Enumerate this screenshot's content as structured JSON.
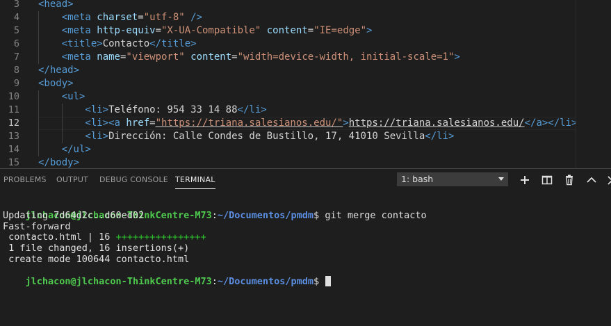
{
  "editor": {
    "lines": [
      {
        "num": "3",
        "active": false,
        "indent": 0,
        "tokens": [
          {
            "t": "tag",
            "v": "<head>"
          }
        ]
      },
      {
        "num": "4",
        "active": false,
        "indent": 1,
        "tokens": [
          {
            "t": "tag",
            "v": "<meta "
          },
          {
            "t": "attr",
            "v": "charset"
          },
          {
            "t": "txt",
            "v": "="
          },
          {
            "t": "str",
            "v": "\"utf-8\""
          },
          {
            "t": "tag",
            "v": " />"
          }
        ]
      },
      {
        "num": "5",
        "active": false,
        "indent": 1,
        "tokens": [
          {
            "t": "tag",
            "v": "<meta "
          },
          {
            "t": "attr",
            "v": "http-equiv"
          },
          {
            "t": "txt",
            "v": "="
          },
          {
            "t": "str",
            "v": "\"X-UA-Compatible\""
          },
          {
            "t": "txt",
            "v": " "
          },
          {
            "t": "attr",
            "v": "content"
          },
          {
            "t": "txt",
            "v": "="
          },
          {
            "t": "str",
            "v": "\"IE=edge\""
          },
          {
            "t": "tag",
            "v": ">"
          }
        ]
      },
      {
        "num": "6",
        "active": false,
        "indent": 1,
        "tokens": [
          {
            "t": "tag",
            "v": "<title>"
          },
          {
            "t": "txt",
            "v": "Contacto"
          },
          {
            "t": "tag",
            "v": "</title>"
          }
        ]
      },
      {
        "num": "7",
        "active": false,
        "indent": 1,
        "tokens": [
          {
            "t": "tag",
            "v": "<meta "
          },
          {
            "t": "attr",
            "v": "name"
          },
          {
            "t": "txt",
            "v": "="
          },
          {
            "t": "str",
            "v": "\"viewport\""
          },
          {
            "t": "txt",
            "v": " "
          },
          {
            "t": "attr",
            "v": "content"
          },
          {
            "t": "txt",
            "v": "="
          },
          {
            "t": "str",
            "v": "\"width=device-width, initial-scale=1\""
          },
          {
            "t": "tag",
            "v": ">"
          }
        ]
      },
      {
        "num": "8",
        "active": false,
        "indent": 0,
        "tokens": [
          {
            "t": "tag",
            "v": "</head>"
          }
        ]
      },
      {
        "num": "9",
        "active": false,
        "indent": 0,
        "tokens": [
          {
            "t": "tag",
            "v": "<body>"
          }
        ]
      },
      {
        "num": "10",
        "active": false,
        "indent": 1,
        "tokens": [
          {
            "t": "tag",
            "v": "<ul>"
          }
        ]
      },
      {
        "num": "11",
        "active": false,
        "indent": 2,
        "tokens": [
          {
            "t": "tag",
            "v": "<li>"
          },
          {
            "t": "txt",
            "v": "Teléfono: 954 33 14 88"
          },
          {
            "t": "tag",
            "v": "</li>"
          }
        ]
      },
      {
        "num": "12",
        "active": true,
        "indent": 2,
        "tokens": [
          {
            "t": "tag",
            "v": "<li>"
          },
          {
            "t": "tag",
            "v": "<a "
          },
          {
            "t": "attr",
            "v": "href"
          },
          {
            "t": "txt",
            "v": "="
          },
          {
            "t": "str ul",
            "v": "\"https://triana.salesianos.edu/\""
          },
          {
            "t": "tag",
            "v": ">"
          },
          {
            "t": "txt ul",
            "v": "https://triana.salesianos.edu/"
          },
          {
            "t": "tag",
            "v": "</a></li>"
          }
        ]
      },
      {
        "num": "13",
        "active": false,
        "indent": 2,
        "tokens": [
          {
            "t": "tag",
            "v": "<li>"
          },
          {
            "t": "txt",
            "v": "Dirección: Calle Condes de Bustillo, 17, 41010 Sevilla"
          },
          {
            "t": "tag",
            "v": "</li>"
          }
        ]
      },
      {
        "num": "14",
        "active": false,
        "indent": 1,
        "tokens": [
          {
            "t": "tag",
            "v": "</ul>"
          }
        ]
      },
      {
        "num": "15",
        "active": false,
        "indent": 0,
        "tokens": [
          {
            "t": "tag",
            "v": "</body>"
          }
        ]
      }
    ]
  },
  "panel": {
    "tabs": [
      {
        "label": "PROBLEMS",
        "active": false
      },
      {
        "label": "OUTPUT",
        "active": false
      },
      {
        "label": "DEBUG CONSOLE",
        "active": false
      },
      {
        "label": "TERMINAL",
        "active": true
      }
    ],
    "terminal_select": "1: bash",
    "actions": [
      "plus-icon",
      "split-icon",
      "trash-icon",
      "chevron-up-icon",
      "close-icon"
    ]
  },
  "terminal": {
    "prompt_user": "jlchacon@jlchacon-ThinkCentre-M73",
    "prompt_sep": ":",
    "prompt_path": "~/Documentos/pmdm",
    "prompt_end": "$ ",
    "command": "git merge contacto",
    "output": [
      "Updating 7d64d2c..d60ed02",
      "Fast-forward",
      " contacto.html | 16 ",
      " 1 file changed, 16 insertions(+)",
      " create mode 100644 contacto.html"
    ],
    "plus_bar": "++++++++++++++++"
  },
  "colors": {
    "background": "#1e1e1e",
    "tag": "#569cd6",
    "attribute": "#9cdcfe",
    "string": "#ce9178",
    "prompt_user": "#4ec94e",
    "prompt_path": "#5b8ee0",
    "diff_plus": "#2dc02d"
  }
}
